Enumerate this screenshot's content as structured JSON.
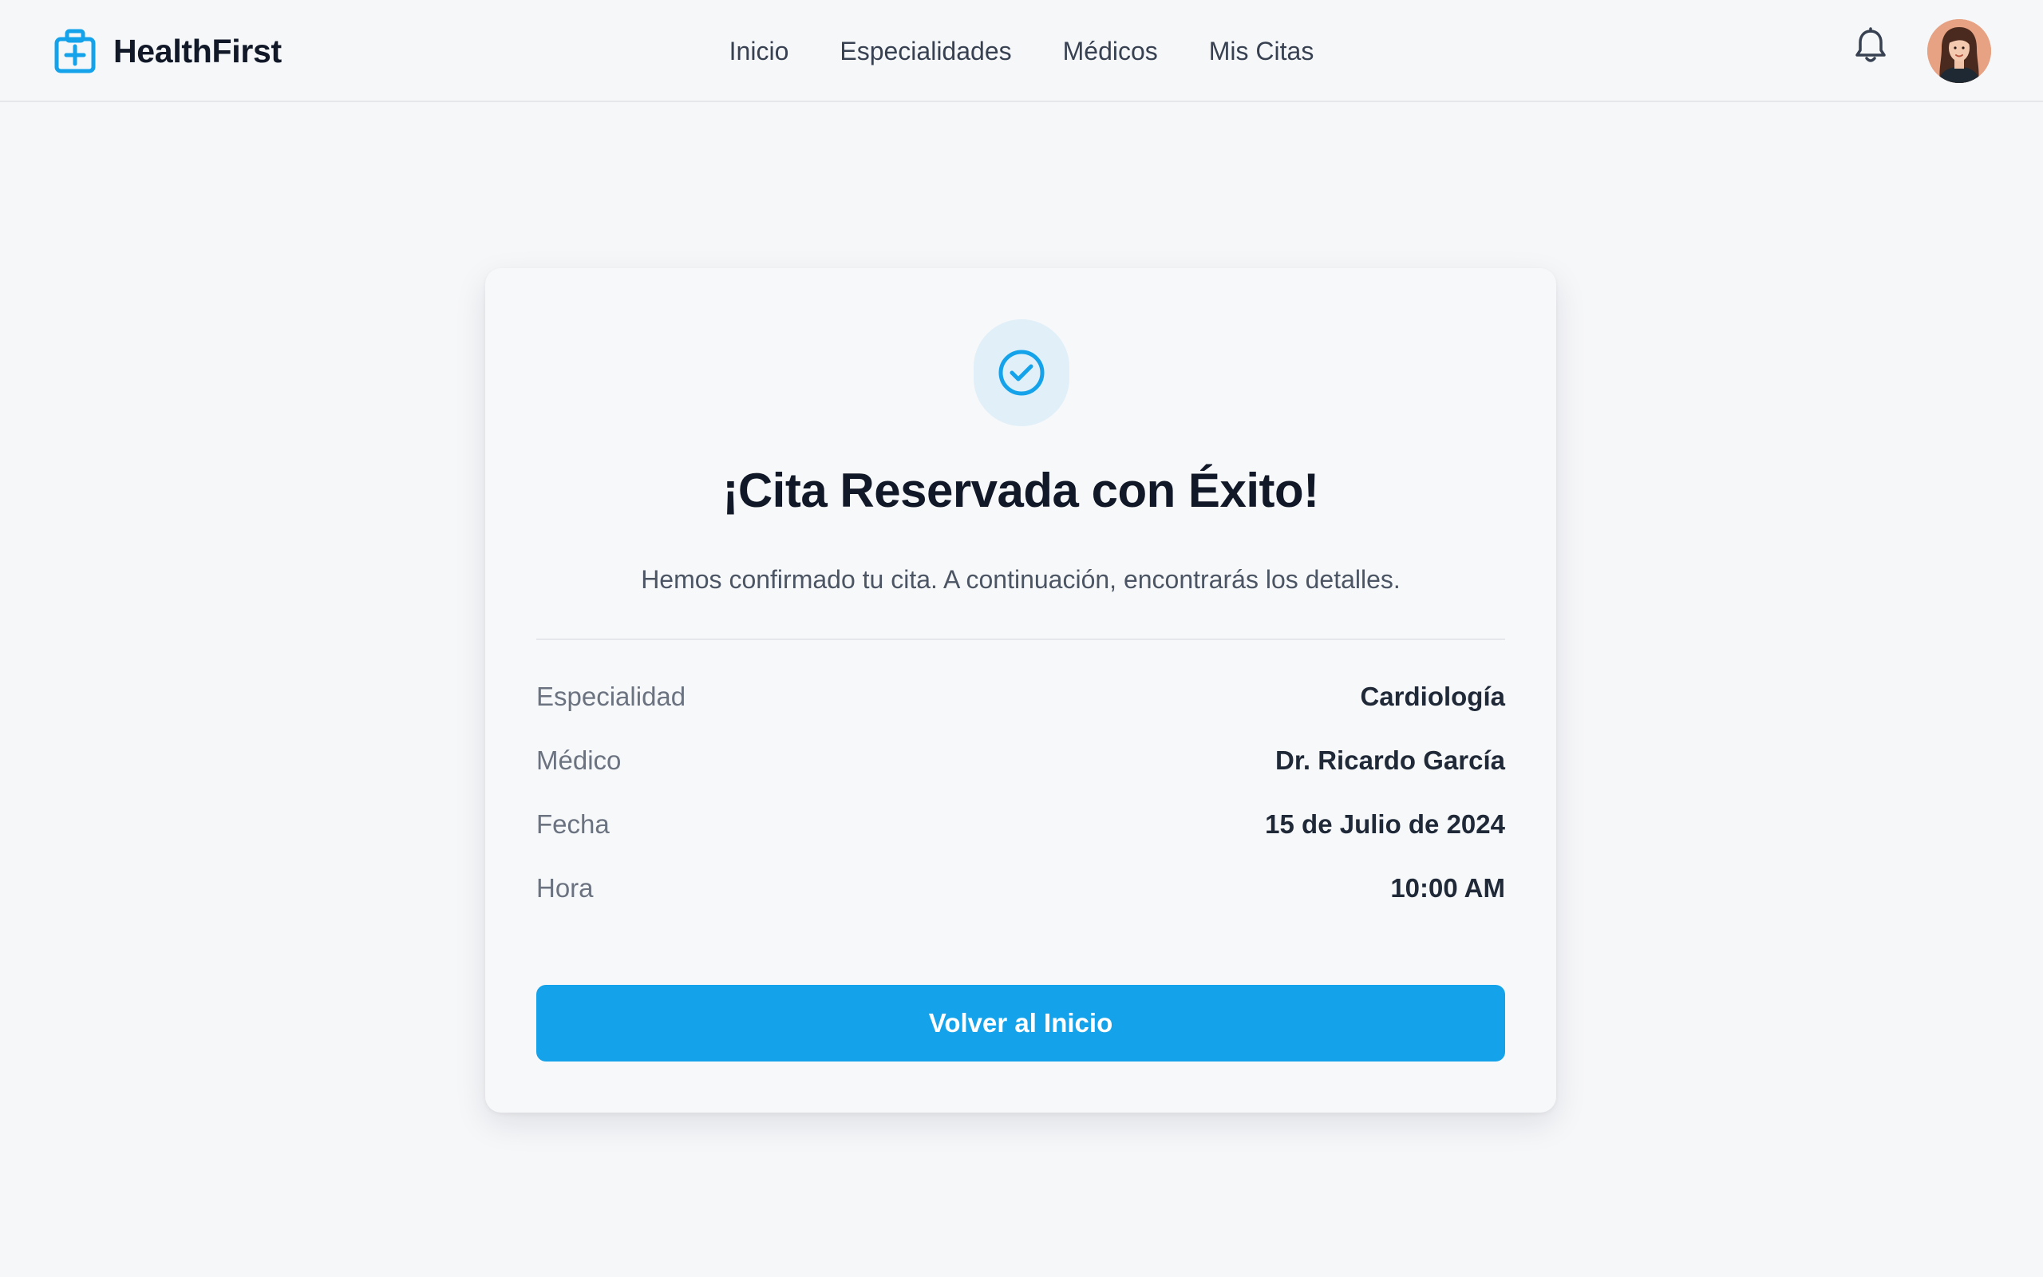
{
  "header": {
    "brand": "HealthFirst",
    "nav": [
      "Inicio",
      "Especialidades",
      "Médicos",
      "Mis Citas"
    ]
  },
  "confirmation": {
    "title": "¡Cita Reservada con Éxito!",
    "subtitle": "Hemos confirmado tu cita. A continuación, encontrarás los detalles.",
    "details": [
      {
        "label": "Especialidad",
        "value": "Cardiología"
      },
      {
        "label": "Médico",
        "value": "Dr. Ricardo García"
      },
      {
        "label": "Fecha",
        "value": "15 de Julio de 2024"
      },
      {
        "label": "Hora",
        "value": "10:00 AM"
      }
    ],
    "button_label": "Volver al Inicio"
  },
  "icons": {
    "brand": "medical-kit-icon",
    "notifications": "bell-icon",
    "success": "check-circle-icon"
  },
  "colors": {
    "accent": "#14a3ea",
    "page_background": "#f6f7f9",
    "success_badge_background": "#e0eff8",
    "text_primary": "#111827",
    "text_secondary": "#6b7280"
  }
}
